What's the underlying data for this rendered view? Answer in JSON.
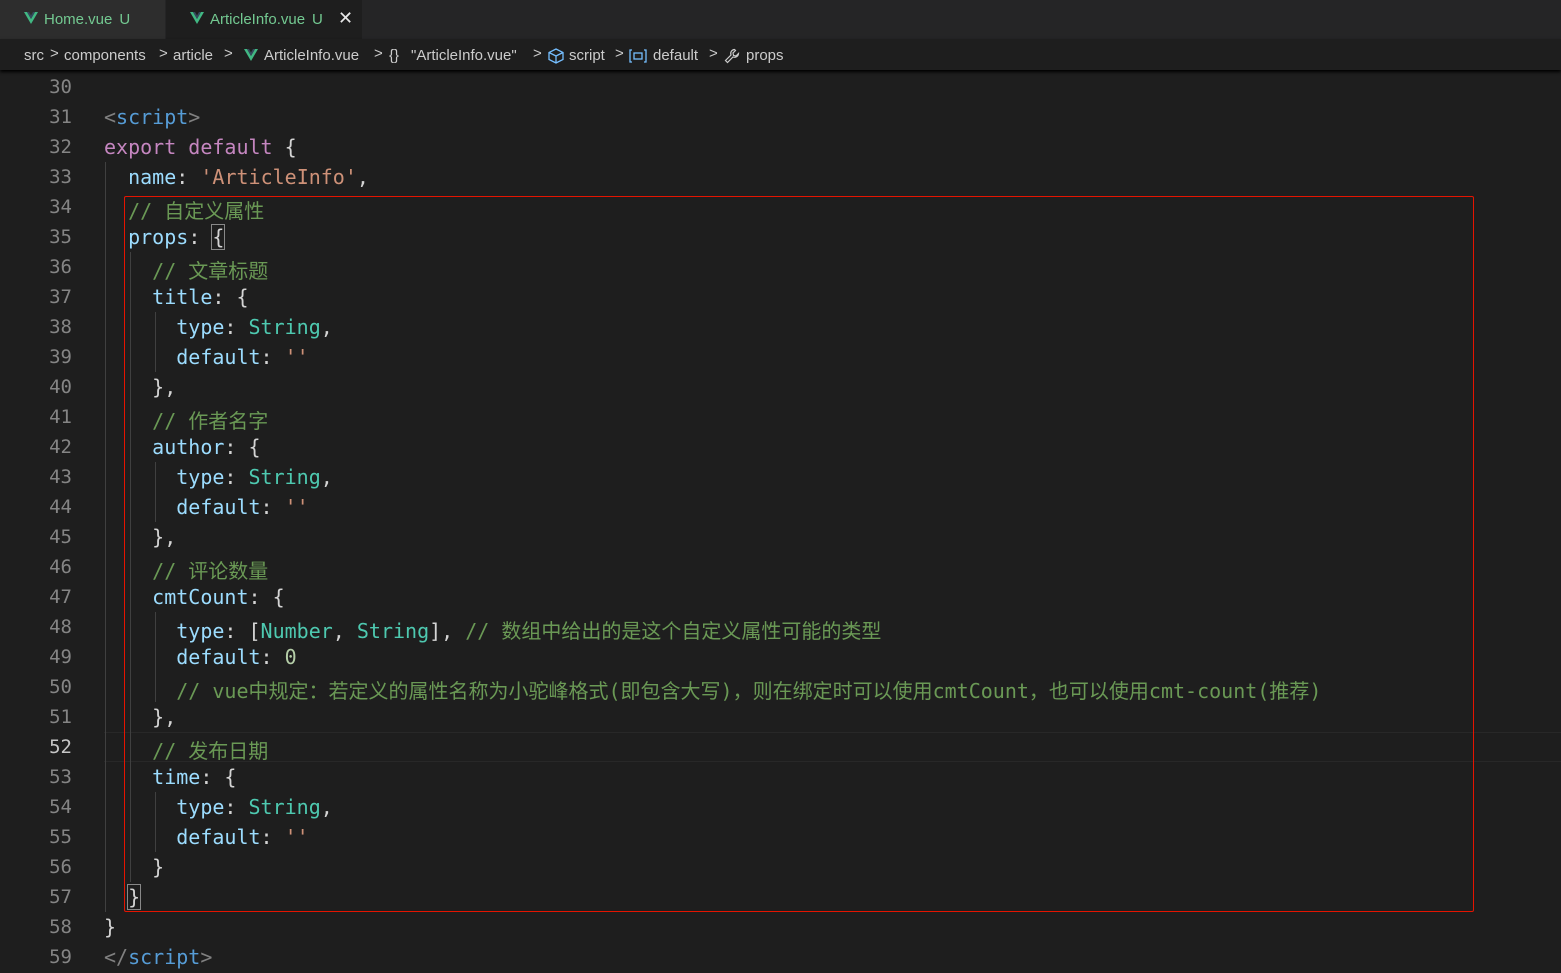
{
  "tabs": [
    {
      "name": "Home.vue",
      "status": "U"
    },
    {
      "name": "ArticleInfo.vue",
      "status": "U",
      "close": "✕"
    }
  ],
  "breadcrumb": {
    "src": "src",
    "components": "components",
    "article": "article",
    "file": "ArticleInfo.vue",
    "module": "\"ArticleInfo.vue\"",
    "script": "script",
    "default": "default",
    "props": "props",
    "module_icon": "{}",
    "separator": ">"
  },
  "editor": {
    "active_line": 52,
    "line_numbers": [
      "30",
      "31",
      "32",
      "33",
      "34",
      "35",
      "36",
      "37",
      "38",
      "39",
      "40",
      "41",
      "42",
      "43",
      "44",
      "45",
      "46",
      "47",
      "48",
      "49",
      "50",
      "51",
      "52",
      "53",
      "54",
      "55",
      "56",
      "57",
      "58",
      "59"
    ],
    "lines": {
      "l31_open": "<",
      "l31_tag": "script",
      "l31_close": ">",
      "l32_export": "export",
      "l32_default": "default",
      "l32_brace": " {",
      "l33_key": "name",
      "l33_colon": ": ",
      "l33_val": "'ArticleInfo'",
      "l33_comma": ",",
      "l34": "// 自定义属性",
      "l35_key": "props",
      "l35_colon": ": ",
      "l35_brace": "{",
      "l36": "// 文章标题",
      "l37_key": "title",
      "l37_rest": ": {",
      "l38_key": "type",
      "l38_colon": ": ",
      "l38_val": "String",
      "l38_comma": ",",
      "l39_key": "default",
      "l39_colon": ": ",
      "l39_val": "''",
      "l40": "},",
      "l41": "// 作者名字",
      "l42_key": "author",
      "l42_rest": ": {",
      "l43_key": "type",
      "l43_colon": ": ",
      "l43_val": "String",
      "l43_comma": ",",
      "l44_key": "default",
      "l44_colon": ": ",
      "l44_val": "''",
      "l45": "},",
      "l46": "// 评论数量",
      "l47_key": "cmtCount",
      "l47_rest": ": {",
      "l48_key": "type",
      "l48_colon": ": [",
      "l48_t1": "Number",
      "l48_sep": ", ",
      "l48_t2": "String",
      "l48_end": "], ",
      "l48_cmt": "// 数组中给出的是这个自定义属性可能的类型",
      "l49_key": "default",
      "l49_colon": ": ",
      "l49_val": "0",
      "l50": "// vue中规定：若定义的属性名称为小驼峰格式(即包含大写)，则在绑定时可以使用cmtCount，也可以使用cmt-count(推荐)",
      "l51": "},",
      "l52": "// 发布日期",
      "l53_key": "time",
      "l53_rest": ": {",
      "l54_key": "type",
      "l54_colon": ": ",
      "l54_val": "String",
      "l54_comma": ",",
      "l55_key": "default",
      "l55_colon": ": ",
      "l55_val": "''",
      "l56": "}",
      "l57": "}",
      "l58": "}",
      "l59_open": "</",
      "l59_tag": "script",
      "l59_close": ">"
    }
  },
  "colors": {
    "highlight_box": "#e51400",
    "vue_green": "#41b883",
    "untracked": "#73c991"
  }
}
